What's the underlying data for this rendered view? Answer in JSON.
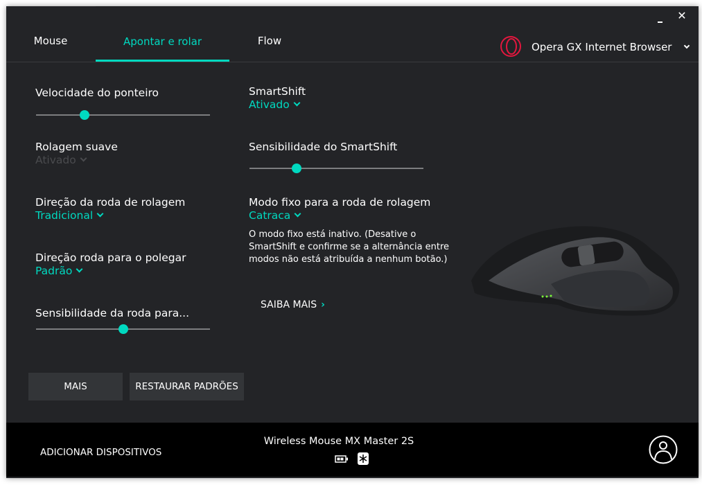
{
  "window": {
    "minimize_icon": "minimize-icon",
    "close_icon": "close-icon"
  },
  "tabs": [
    {
      "label": "Mouse",
      "active": false
    },
    {
      "label": "Apontar e rolar",
      "active": true
    },
    {
      "label": "Flow",
      "active": false
    }
  ],
  "app_selector": {
    "label": "Opera GX Internet Browser",
    "icon": "opera-gx-logo",
    "color": "#e3173e"
  },
  "left": {
    "pointer_speed": {
      "label": "Velocidade do ponteiro",
      "value": 0.28
    },
    "smooth_scroll": {
      "label": "Rolagem suave",
      "value": "Ativado",
      "disabled": true
    },
    "scroll_direction": {
      "label": "Direção da roda de rolagem",
      "value": "Tradicional"
    },
    "thumb_direction": {
      "label": "Direção roda para o polegar",
      "value": "Padrão"
    },
    "thumb_sensitivity": {
      "label": "Sensibilidade da roda para...",
      "value": 0.5
    }
  },
  "right": {
    "smartshift": {
      "label": "SmartShift",
      "value": "Ativado"
    },
    "smartshift_sensitivity": {
      "label": "Sensibilidade do SmartShift",
      "value": 0.27
    },
    "ratchet_mode": {
      "label": "Modo fixo para a roda de rolagem",
      "value": "Catraca"
    },
    "note": "O modo fixo está inativo. (Desative o SmartShift e confirme se a alternância entre modos não está atribuída a nenhum botão.)",
    "learn_more": "SAIBA MAIS"
  },
  "buttons": {
    "more": "MAIS",
    "restore": "RESTAURAR PADRÕES"
  },
  "footer": {
    "add_devices": "ADICIONAR DISPOSITIVOS",
    "device_name": "Wireless Mouse MX Master 2S",
    "battery_icon": "battery-icon",
    "receiver_icon": "unifying-receiver-icon",
    "account_icon": "account-icon"
  },
  "colors": {
    "accent": "#00d9c0",
    "background": "#232427",
    "footer": "#000000"
  }
}
